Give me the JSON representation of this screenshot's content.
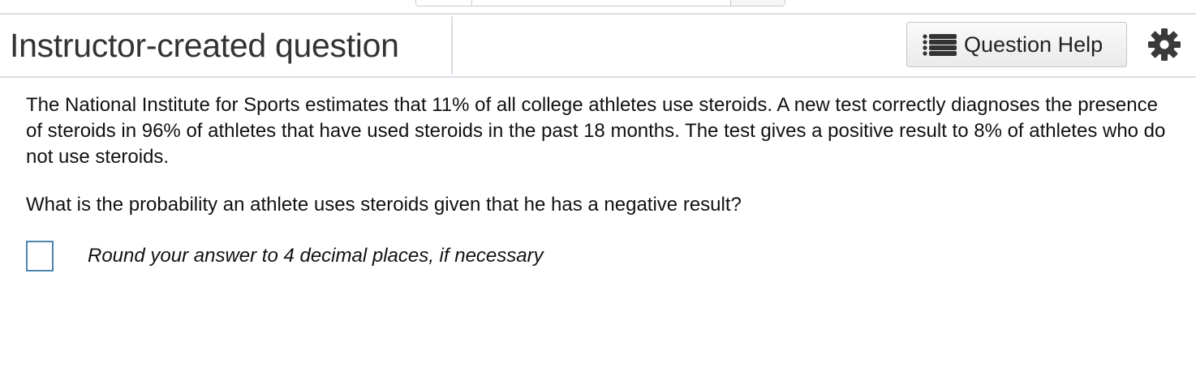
{
  "header": {
    "title": "Instructor-created question",
    "help_button_label": "Question Help"
  },
  "icons": {
    "help": "list-icon",
    "settings": "gear-icon"
  },
  "colors": {
    "answer_box_border": "#4f86ad"
  },
  "question": {
    "prompt": "The National Institute for Sports estimates that 11% of all college athletes use steroids. A new  test correctly diagnoses the presence of steroids in 96% of athletes that have used steroids in the past 18 months. The test gives a positive result to 8% of athletes who do not use steroids.",
    "text": "What is the probability an athlete uses steroids given that he has a negative result?",
    "answer_value": "",
    "hint": "Round your answer to 4 decimal places, if necessary"
  }
}
